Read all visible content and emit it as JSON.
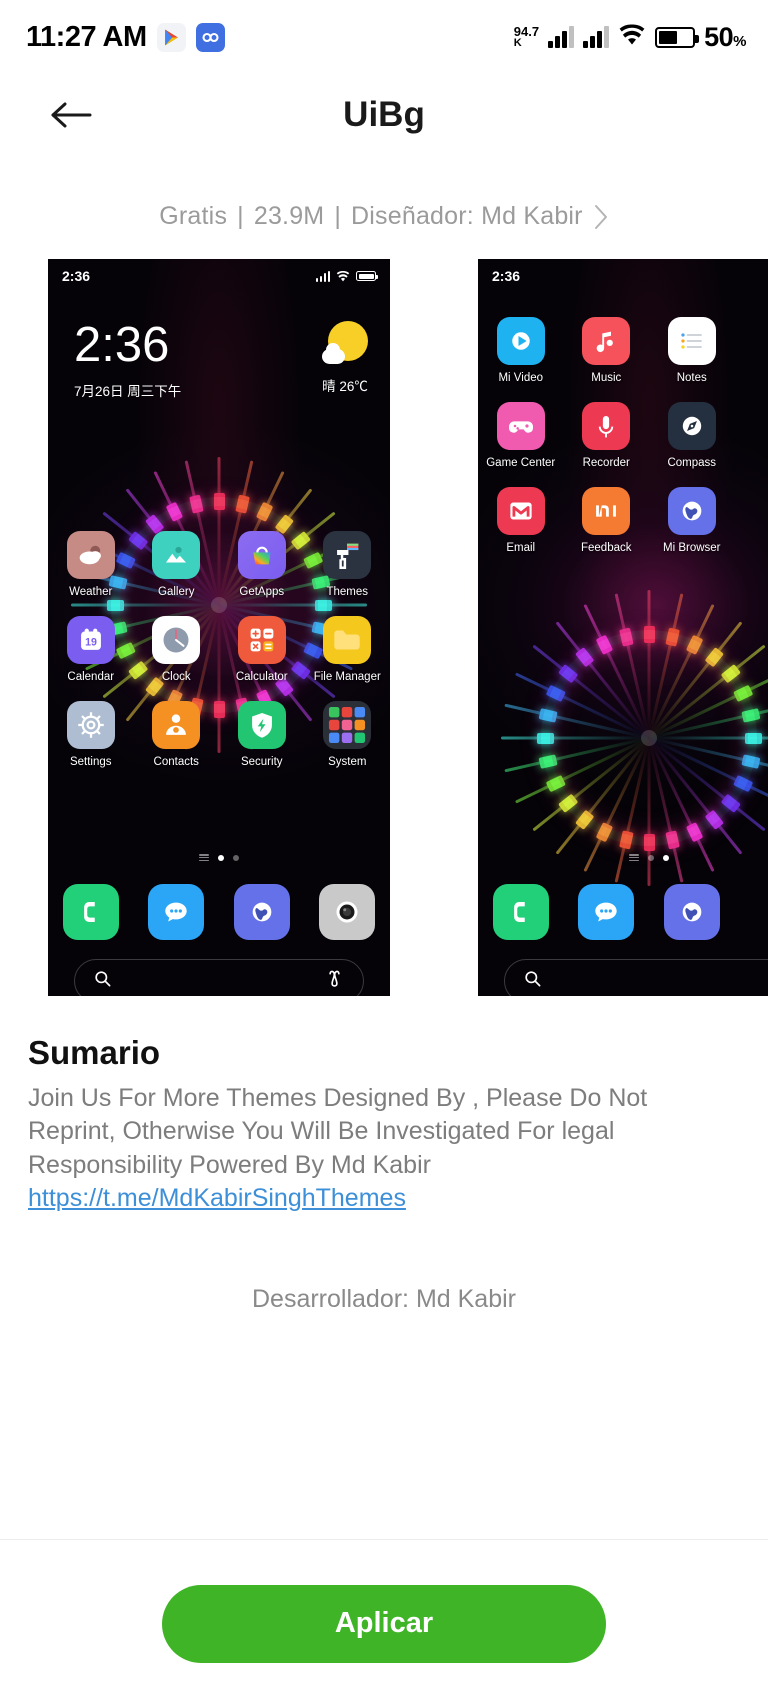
{
  "status_bar": {
    "time": "11:27 AM",
    "icons": [
      "play-store-icon",
      "loop-app-icon"
    ],
    "net_speed_value": "94.7",
    "net_speed_unit": "K",
    "battery_percent": "50",
    "battery_percent_symbol": "%"
  },
  "app_bar": {
    "back_label": "back-arrow",
    "title": "UiBg"
  },
  "meta": {
    "price": "Gratis",
    "sep1": "|",
    "size": "23.9M",
    "sep2": "|",
    "designer": "Diseñador: Md Kabir"
  },
  "previews": [
    {
      "status_time": "2:36",
      "clock_time": "2:36",
      "clock_date": "7月26日 周三下午",
      "weather": "晴 26℃",
      "rows": [
        [
          "Weather",
          "Gallery",
          "GetApps",
          "Themes"
        ],
        [
          "Calendar",
          "Clock",
          "Calculator",
          "File Manager"
        ],
        [
          "Settings",
          "Contacts",
          "Security",
          "System"
        ]
      ],
      "calendar_day": "19",
      "dock": [
        "phone-icon",
        "messages-icon",
        "browser-icon",
        "camera-icon"
      ],
      "search_icons": [
        "search-icon",
        "mi-ai-icon"
      ]
    },
    {
      "status_time": "2:36",
      "rows": [
        [
          "Mi Video",
          "Music",
          "Notes"
        ],
        [
          "Game Center",
          "Recorder",
          "Compass"
        ],
        [
          "Email",
          "Feedback",
          "Mi Browser"
        ]
      ],
      "dock": [
        "phone-icon",
        "messages-icon",
        "browser-icon"
      ],
      "search_icons": [
        "search-icon"
      ]
    }
  ],
  "summary": {
    "heading": "Sumario",
    "body": "Join Us For More Themes Designed By , Please Do Not Reprint, Otherwise You Will Be Investigated For legal Responsibility Powered By Md Kabir",
    "link": "https://t.me/MdKabirSinghThemes",
    "developer": "Desarrollador: Md Kabir"
  },
  "bottom_bar": {
    "apply_label": "Aplicar"
  },
  "colors": {
    "accent_green": "#3fb427",
    "link_blue": "#3d8fd8",
    "muted_gray": "#9b9b9b"
  }
}
